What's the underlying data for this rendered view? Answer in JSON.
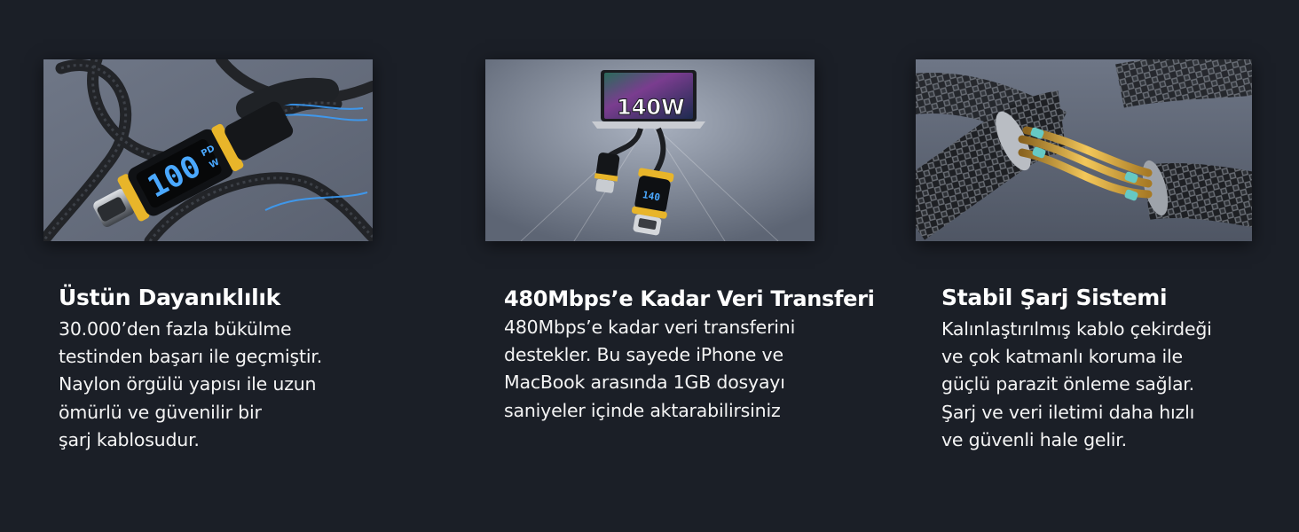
{
  "features": [
    {
      "image_text": "100",
      "image_badge_top": "PD",
      "image_badge_bottom": "W",
      "title": "Üstün Dayanıklılık",
      "lines": [
        "30.000’den fazla bükülme",
        "testinden başarı ile geçmiştir.",
        "Naylon örgülü yapısı ile uzun",
        "ömürlü ve güvenilir bir",
        "şarj kablosudur."
      ]
    },
    {
      "image_text": "140W",
      "image_badge_top": "140",
      "title": "480Mbps’e Kadar Veri Transferi",
      "lines": [
        "480Mbps’e kadar veri transferini",
        "destekler. Bu sayede iPhone ve",
        "MacBook arasında 1GB dosyayı",
        "saniyeler içinde aktarabilirsiniz"
      ]
    },
    {
      "title": "Stabil Şarj Sistemi",
      "lines": [
        "Kalınlaştırılmış kablo çekirdeği",
        "ve çok katmanlı koruma ile",
        "güçlü parazit önleme sağlar.",
        "Şarj ve veri iletimi daha hızlı",
        "ve güvenli hale gelir."
      ]
    }
  ],
  "colors": {
    "background": "#1b1f27",
    "accent_yellow": "#e8b52a",
    "display_blue": "#4aa8ff"
  }
}
